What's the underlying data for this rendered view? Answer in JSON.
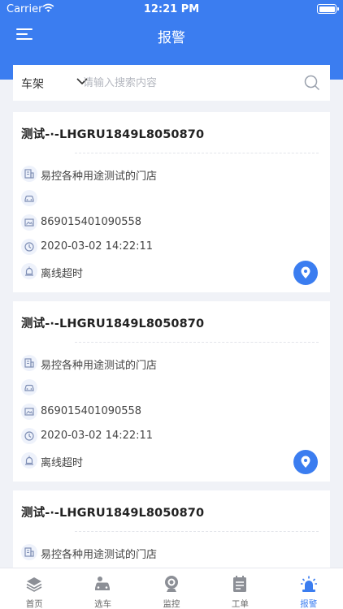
{
  "status_bar": {
    "carrier": "Carrier",
    "time": "12:21 PM"
  },
  "header": {
    "title": "报警"
  },
  "search": {
    "filter_label": "车架",
    "placeholder": "请输入搜索内容",
    "value": ""
  },
  "alarms": [
    {
      "title": "测试-·-LHGRU1849L8050870",
      "store": "易控各种用途测试的门店",
      "vehicle": "",
      "imei": "869015401090558",
      "time": "2020-03-02 14:22:11",
      "alarm_type": "离线超时"
    },
    {
      "title": "测试-·-LHGRU1849L8050870",
      "store": "易控各种用途测试的门店",
      "vehicle": "",
      "imei": "869015401090558",
      "time": "2020-03-02 14:22:11",
      "alarm_type": "离线超时"
    },
    {
      "title": "测试-·-LHGRU1849L8050870",
      "store": "易控各种用途测试的门店"
    }
  ],
  "tabbar": {
    "tabs": [
      {
        "label": "首页",
        "icon": "home-stack-icon"
      },
      {
        "label": "选车",
        "icon": "car-select-icon"
      },
      {
        "label": "监控",
        "icon": "camera-monitor-icon"
      },
      {
        "label": "工单",
        "icon": "work-order-icon"
      },
      {
        "label": "报警",
        "icon": "siren-icon"
      }
    ],
    "active": "报警"
  },
  "colors": {
    "accent": "#3b7df0",
    "background": "#f0f2f7",
    "icon_muted": "#7f8fb5"
  }
}
